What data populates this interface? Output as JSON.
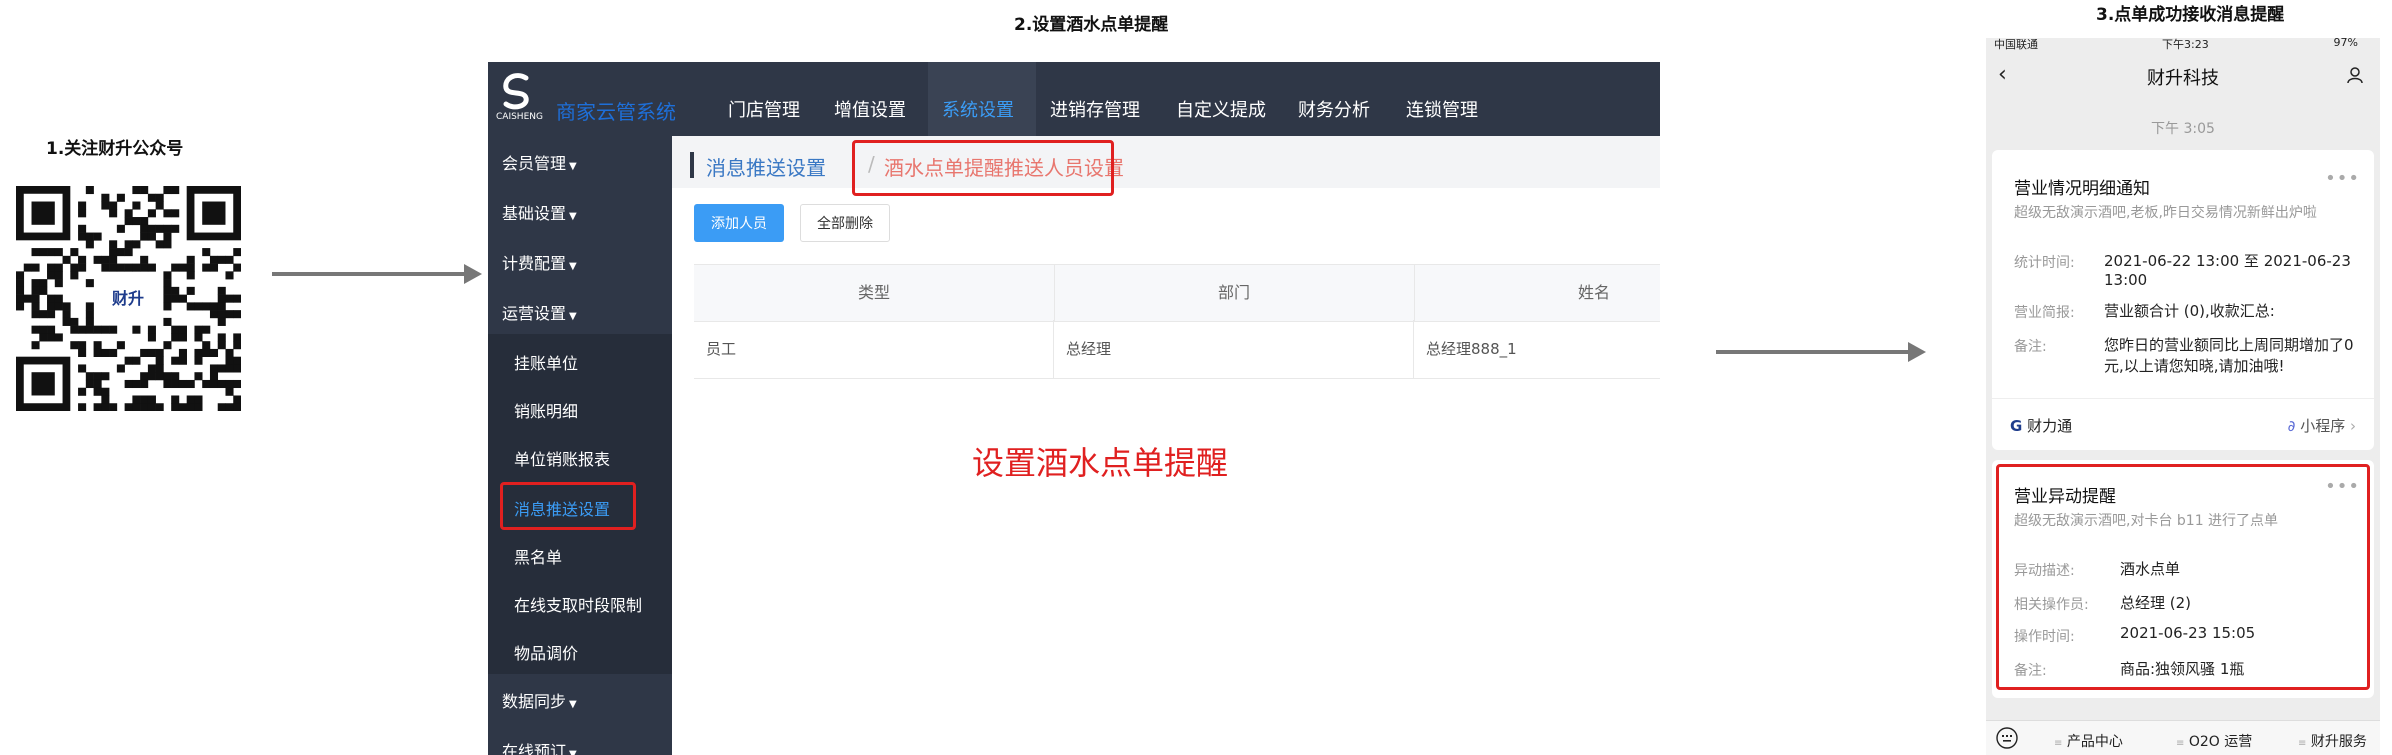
{
  "steps": {
    "step1": "1.关注财升公众号",
    "step2": "2.设置酒水点单提醒",
    "step3": "3.点单成功接收消息提醒"
  },
  "qr": {
    "center_label": "财升"
  },
  "admin": {
    "logo_caption": "CAISHENG",
    "brand": "商家云管系统",
    "nav": [
      "门店管理",
      "增值设置",
      "系统设置",
      "进销存管理",
      "自定义提成",
      "财务分析",
      "连锁管理"
    ],
    "sidebar": {
      "groups": [
        "会员管理",
        "基础设置",
        "计费配置",
        "运营设置",
        "数据同步",
        "在线预订"
      ],
      "items": [
        "挂账单位",
        "销账明细",
        "单位销账报表",
        "消息推送设置",
        "黑名单",
        "在线支取时段限制",
        "物品调价"
      ]
    },
    "breadcrumb": {
      "parent": "消息推送设置",
      "separator": "/",
      "current": "酒水点单提醒推送人员设置"
    },
    "buttons": {
      "add": "添加人员",
      "delete_all": "全部删除"
    },
    "table": {
      "headers": [
        "类型",
        "部门",
        "姓名"
      ],
      "rows": [
        [
          "员工",
          "总经理",
          "总经理888_1"
        ]
      ]
    },
    "annotation": "设置酒水点单提醒"
  },
  "phone": {
    "status_left": "中国联通",
    "status_center": "下午3:23",
    "status_right": "97%",
    "title": "财升科技",
    "time_tag": "下午 3:05",
    "card1": {
      "title": "营业情况明细通知",
      "subtitle": "超级无敌演示酒吧,老板,昨日交易情况新鲜出炉啦",
      "fields": [
        {
          "k": "统计时间:",
          "v": "2021-06-22 13:00 至 2021-06-23 13:00"
        },
        {
          "k": "营业简报:",
          "v": "营业额合计 (0),收款汇总:"
        },
        {
          "k": "备注:",
          "v": "您昨日的营业额同比上周同期增加了0元,以上请您知晓,请加油哦!"
        }
      ],
      "footer_left": "财力通",
      "footer_right": "小程序"
    },
    "card2": {
      "title": "营业异动提醒",
      "subtitle": "超级无敌演示酒吧,对卡台 b11 进行了点单",
      "fields": [
        {
          "k": "异动描述:",
          "v": "酒水点单"
        },
        {
          "k": "相关操作员:",
          "v": "总经理 (2)"
        },
        {
          "k": "操作时间:",
          "v": "2021-06-23 15:05"
        },
        {
          "k": "备注:",
          "v": "商品:独领风骚 1瓶"
        }
      ]
    },
    "bottom_menu": [
      "产品中心",
      "O2O 运营",
      "财升服务"
    ]
  },
  "colors": {
    "accent": "#3b9cf5",
    "highlight_red": "#e02020",
    "dark_nav": "#2f3747"
  }
}
